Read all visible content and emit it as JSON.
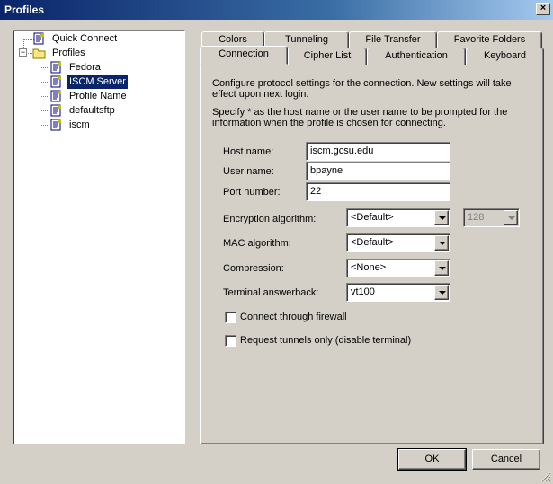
{
  "window": {
    "title": "Profiles",
    "close_glyph": "×"
  },
  "tree": {
    "items": [
      {
        "label": "Quick Connect",
        "icon": "profile-icon"
      },
      {
        "label": "Profiles",
        "icon": "folder-icon",
        "expander": "−"
      },
      {
        "label": "Fedora",
        "icon": "profile-icon"
      },
      {
        "label": "ISCM Server",
        "icon": "profile-icon",
        "selected": true
      },
      {
        "label": "Profile Name",
        "icon": "profile-icon"
      },
      {
        "label": "defaultsftp",
        "icon": "profile-icon"
      },
      {
        "label": "iscm",
        "icon": "profile-icon"
      }
    ]
  },
  "tabs": {
    "back_row": [
      "Colors",
      "Tunneling",
      "File Transfer",
      "Favorite Folders"
    ],
    "front_row": [
      "Connection",
      "Cipher List",
      "Authentication",
      "Keyboard"
    ],
    "active": "Connection"
  },
  "connection": {
    "description1": "Configure protocol settings for the connection. New settings will take effect upon next login.",
    "description2": "Specify * as the host name or the user name to be prompted for the information when the profile is chosen for connecting.",
    "host_label": "Host name:",
    "host_value": "iscm.gcsu.edu",
    "user_label": "User name:",
    "user_value": "bpayne",
    "port_label": "Port number:",
    "port_value": "22",
    "encryption_label": "Encryption algorithm:",
    "encryption_value": "<Default>",
    "encryption_bits": "128",
    "mac_label": "MAC algorithm:",
    "mac_value": "<Default>",
    "compression_label": "Compression:",
    "compression_value": "<None>",
    "answerback_label": "Terminal answerback:",
    "answerback_value": "vt100",
    "firewall_label": "Connect through firewall",
    "firewall_checked": false,
    "tunnels_label": "Request tunnels only (disable terminal)",
    "tunnels_checked": false
  },
  "buttons": {
    "ok": "OK",
    "cancel": "Cancel"
  },
  "colors": {
    "titlebar": "#0a246a",
    "selection": "#0a246a",
    "face": "#d4d0c8"
  }
}
